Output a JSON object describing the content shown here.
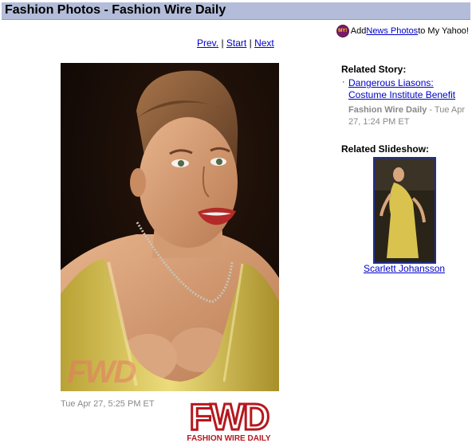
{
  "header": {
    "title": "Fashion Photos - Fashion Wire Daily"
  },
  "yahoo": {
    "badge": "MY!",
    "pre": "Add ",
    "link": "News Photos",
    "post": " to My Yahoo!"
  },
  "nav": {
    "prev": "Prev.",
    "sep1": " | ",
    "start": "Start",
    "sep2": " | ",
    "next": "Next"
  },
  "photo": {
    "watermark": "FWD",
    "timestamp": "Tue Apr 27, 5:25 PM ET"
  },
  "logo": {
    "mark": "FWD",
    "tagline": "FASHION WIRE DAILY"
  },
  "related_story": {
    "heading": "Related Story:",
    "bullet": "·",
    "link": "Dangerous Liasons: Costume Institute Benefit",
    "source": "Fashion Wire Daily",
    "date": " - Tue Apr 27, 1:24 PM ET"
  },
  "related_slideshow": {
    "heading": "Related Slideshow:",
    "caption": "Scarlett Johansson"
  },
  "colors": {
    "title_bar": "#b3bdd9",
    "link": "#0000cc",
    "logo_red": "#b5181e",
    "dress": "#d9c34e"
  }
}
